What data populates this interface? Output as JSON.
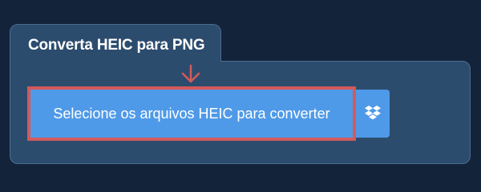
{
  "converter": {
    "tab_title": "Converta HEIC para PNG",
    "select_button_label": "Selecione os arquivos HEIC para converter",
    "dropbox_icon": "dropbox-icon",
    "pointer_icon": "arrow-down-icon"
  },
  "colors": {
    "page_background": "#12233a",
    "panel_background": "#2c4c6e",
    "button_blue": "#4f9ae8",
    "highlight_red": "#d45a5a"
  }
}
